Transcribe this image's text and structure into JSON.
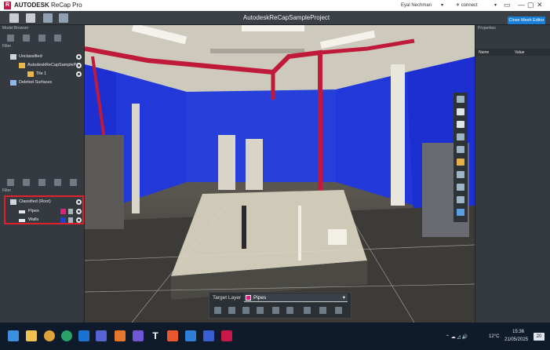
{
  "app": {
    "logo_letter": "R",
    "brand_bold": "AUTODESK",
    "brand_product": "ReCap Pro",
    "project_title": "AutodeskReCapSampleProject",
    "user_name": "Eyal Nechman",
    "connect_label": "connect",
    "close_mesh_label": "Close Mesh Editor",
    "window_controls": [
      "—",
      "▢",
      "✕"
    ]
  },
  "left_panel": {
    "model_browser_label": "Model Browser",
    "filter_label_top": "Filter",
    "tree_top": [
      {
        "label": "Unclassified",
        "icon": "grid-icon"
      },
      {
        "label": "AutodeskReCapSampleP...",
        "icon": "folder-icon"
      },
      {
        "label": "Tile 1",
        "icon": "folder-icon"
      },
      {
        "label": "Deleted Surfaces",
        "icon": "deleted-icon"
      }
    ],
    "filter_label_bottom": "Filter",
    "tree_bottom": [
      {
        "label": "Classified (Root)",
        "icon": "grid-icon"
      },
      {
        "label": "Pipes",
        "color": "#e0207a"
      },
      {
        "label": "Walls",
        "color": "#1f3fd6"
      }
    ]
  },
  "right_panel": {
    "title": "Properties",
    "columns": [
      "Name",
      "Value"
    ]
  },
  "target_layer": {
    "label": "Target Layer",
    "selected": "Pipes",
    "selected_color": "#e0207a"
  },
  "taskbar": {
    "time": "15:36",
    "date": "21/05/2025",
    "weather": "12°C",
    "notification_count": "20",
    "apps": [
      "windows-icon",
      "file-explorer-icon",
      "chrome-icon",
      "edge-icon",
      "outlook-icon",
      "teams-icon",
      "brave-icon",
      "typora-icon",
      "recap-icon"
    ]
  },
  "colors": {
    "accent": "#1a7fd4",
    "highlight": "#e0202a",
    "pipes": "#e0207a",
    "walls": "#1f3fd6"
  }
}
